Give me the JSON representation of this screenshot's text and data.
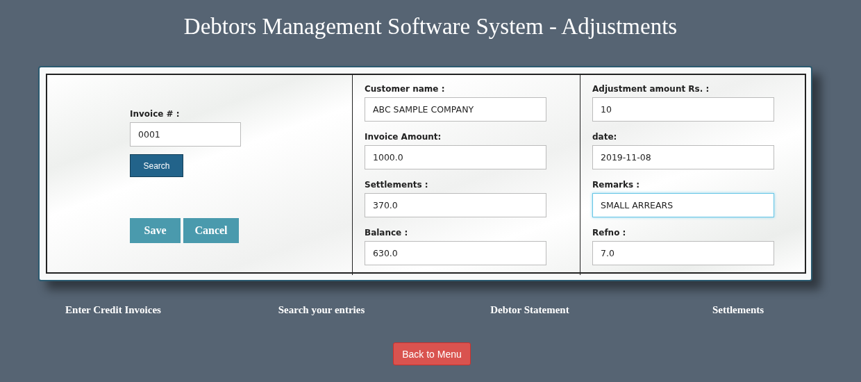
{
  "title": "Debtors Management Software System - Adjustments",
  "search_panel": {
    "label": "Invoice # :",
    "value": "0001",
    "search_button": "Search",
    "save_button": "Save",
    "cancel_button": "Cancel"
  },
  "middle_fields": [
    {
      "label": "Customer name :",
      "value": "ABC SAMPLE COMPANY",
      "focused": false
    },
    {
      "label": "Invoice Amount:",
      "value": "1000.0",
      "focused": false
    },
    {
      "label": "Settlements :",
      "value": "370.0",
      "focused": false
    },
    {
      "label": "Balance :",
      "value": "630.0",
      "focused": false
    }
  ],
  "right_fields": [
    {
      "label": "Adjustment amount Rs. :",
      "value": "10",
      "focused": false
    },
    {
      "label": "date:",
      "value": "2019-11-08",
      "focused": false
    },
    {
      "label": "Remarks :",
      "value": "SMALL ARREARS",
      "focused": true
    },
    {
      "label": "Refno :",
      "value": "7.0",
      "focused": false
    }
  ],
  "nav_links": [
    "Enter Credit Invoices",
    "Search your entries",
    "Debtor Statement",
    "Settlements"
  ],
  "back_button": "Back to Menu"
}
